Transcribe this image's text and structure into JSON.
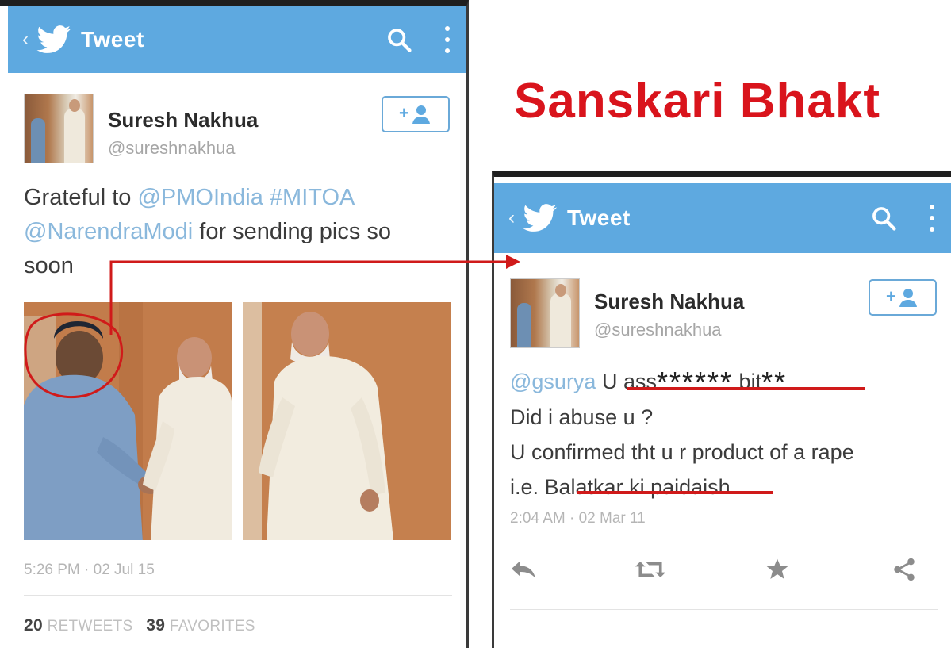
{
  "left_tweet": {
    "appbar": {
      "title": "Tweet"
    },
    "author": {
      "name": "Suresh Nakhua",
      "handle": "@sureshnakhua"
    },
    "text": {
      "prefix": "Grateful to ",
      "mention1": "@PMOIndia",
      "hashtag": "#MITOA",
      "mention2": "@NarendraModi",
      "rest": " for sending pics so",
      "last": "soon"
    },
    "timestamp": "5:26 PM · 02 Jul 15",
    "stats": {
      "retweets_count": "20",
      "retweets_label": "RETWEETS",
      "favorites_count": "39",
      "favorites_label": "FAVORITES"
    }
  },
  "right_tweet": {
    "appbar": {
      "title": "Tweet"
    },
    "author": {
      "name": "Suresh Nakhua",
      "handle": "@sureshnakhua"
    },
    "text": {
      "mention": "@gsurya",
      "line1_a": " U ass",
      "line1_stars": "******",
      "line1_b": " bit",
      "line1_stars2": "**",
      "line2": "Did i abuse u ?",
      "line3": "U confirmed tht u r product of a rape",
      "line4": "i.e. Balatkar ki paidaish"
    },
    "timestamp": "2:04 AM · 02 Mar 11"
  },
  "headline": "Sanskari Bhakt",
  "colors": {
    "twitter_blue": "#5ea9e0",
    "annotation_red": "#d01a1a",
    "headline_red": "#d9141c"
  },
  "icons": [
    "back-chevron-icon",
    "twitter-bird-icon",
    "search-icon",
    "overflow-menu-icon",
    "follow-user-icon",
    "reply-icon",
    "retweet-icon",
    "favorite-star-icon",
    "share-icon"
  ]
}
